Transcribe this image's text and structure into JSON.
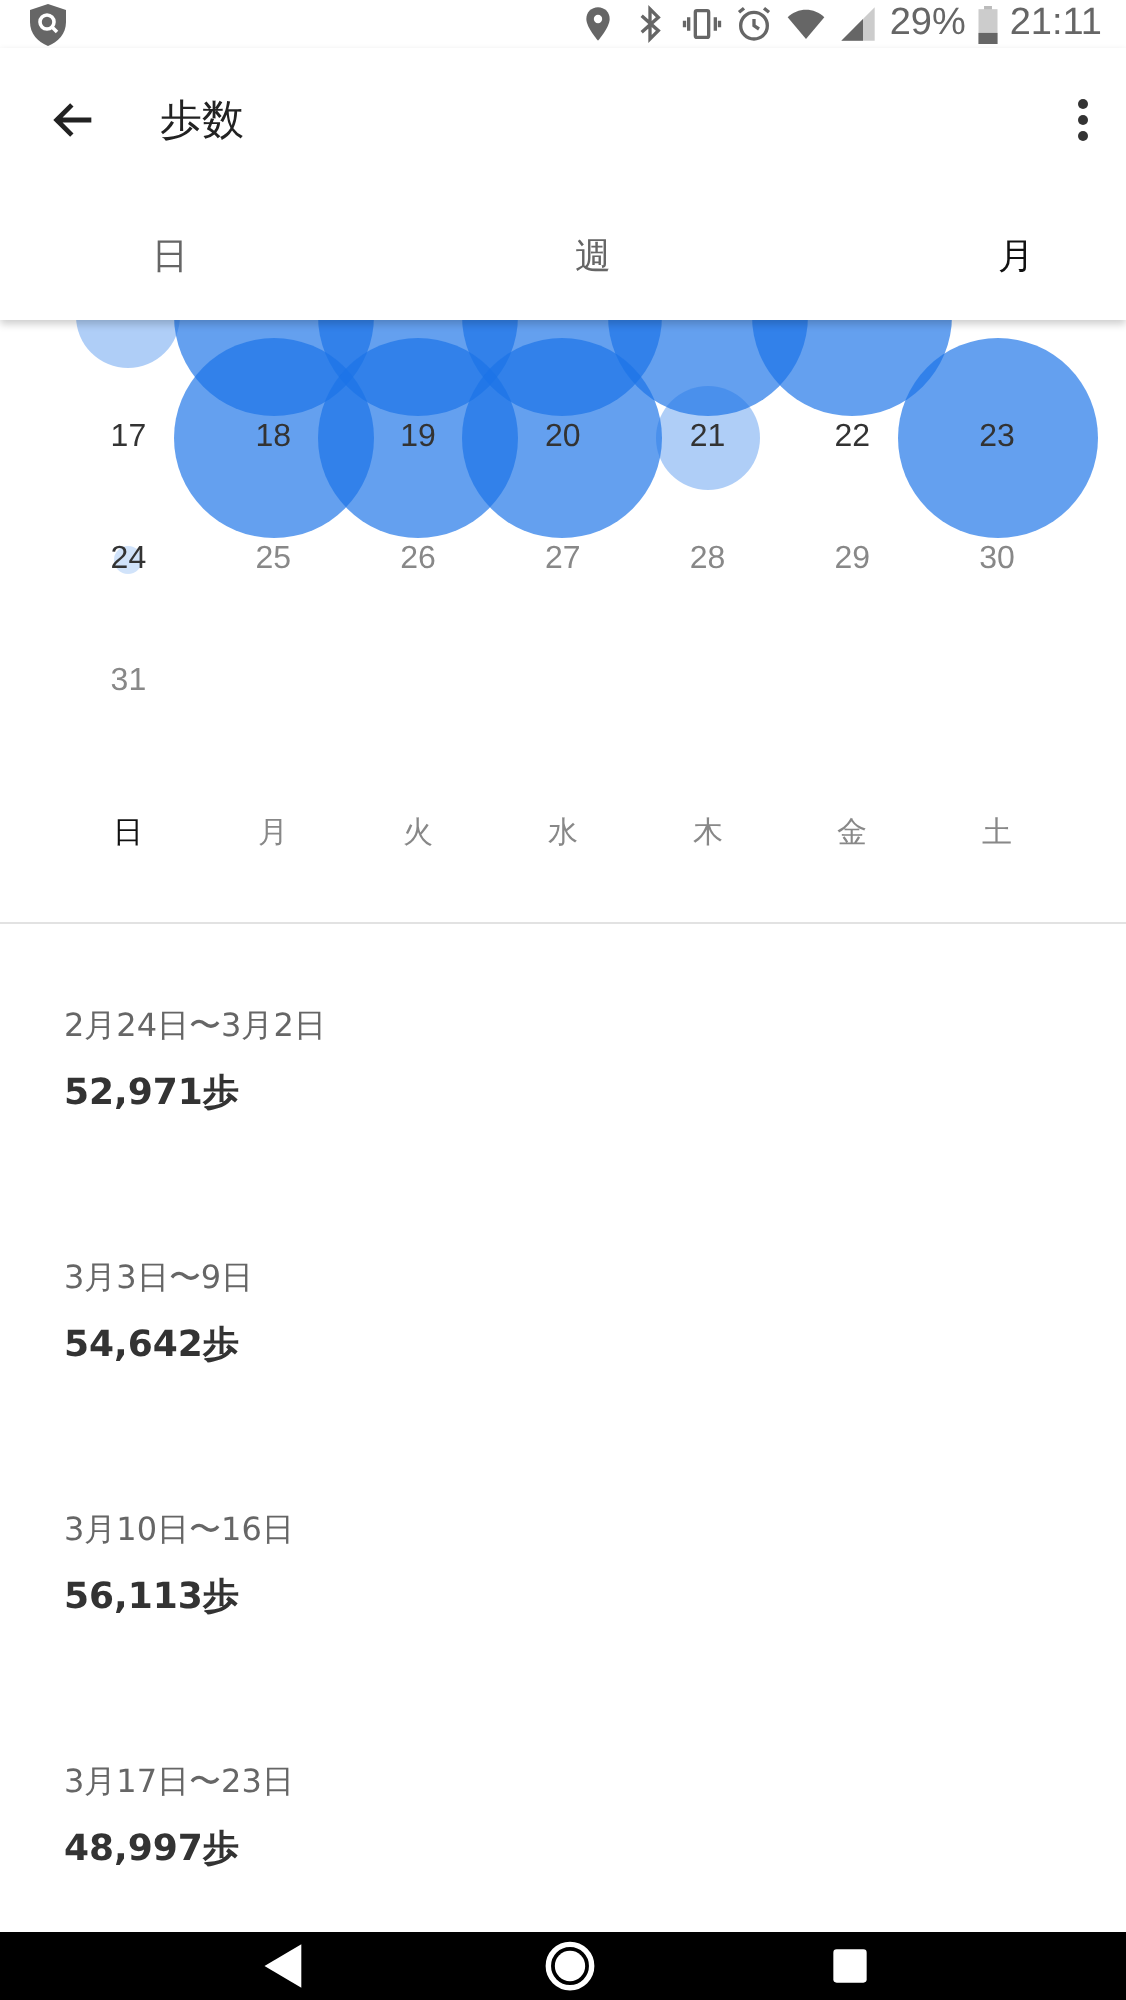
{
  "status_bar": {
    "battery": "29%",
    "time": "21:11"
  },
  "toolbar": {
    "title": "歩数"
  },
  "tabs": [
    {
      "label": "日",
      "selected": false
    },
    {
      "label": "週",
      "selected": false
    },
    {
      "label": "月",
      "selected": true
    }
  ],
  "calendar": {
    "weeks": [
      [
        {
          "kind": "small"
        },
        {
          "kind": "large"
        },
        {
          "kind": "large"
        },
        {
          "kind": "large"
        },
        {
          "kind": "large"
        },
        {
          "kind": "large"
        }
      ],
      [
        {
          "day": "17",
          "kind": "plain",
          "future": false
        },
        {
          "day": "18",
          "kind": "large",
          "future": false
        },
        {
          "day": "19",
          "kind": "large",
          "future": false
        },
        {
          "day": "20",
          "kind": "large",
          "future": false
        },
        {
          "day": "21",
          "kind": "small",
          "future": false
        },
        {
          "day": "22",
          "kind": "plain",
          "future": false
        },
        {
          "day": "23",
          "kind": "large",
          "future": false
        }
      ],
      [
        {
          "day": "24",
          "kind": "tiny",
          "future": false
        },
        {
          "day": "25",
          "kind": "plain",
          "future": true
        },
        {
          "day": "26",
          "kind": "plain",
          "future": true
        },
        {
          "day": "27",
          "kind": "plain",
          "future": true
        },
        {
          "day": "28",
          "kind": "plain",
          "future": true
        },
        {
          "day": "29",
          "kind": "plain",
          "future": true
        },
        {
          "day": "30",
          "kind": "plain",
          "future": true
        }
      ],
      [
        {
          "day": "31",
          "kind": "plain",
          "future": true
        }
      ]
    ],
    "weekdays": [
      {
        "label": "日",
        "highlighted": true
      },
      {
        "label": "月",
        "highlighted": false
      },
      {
        "label": "火",
        "highlighted": false
      },
      {
        "label": "水",
        "highlighted": false
      },
      {
        "label": "木",
        "highlighted": false
      },
      {
        "label": "金",
        "highlighted": false
      },
      {
        "label": "土",
        "highlighted": false
      }
    ]
  },
  "summaries": [
    {
      "range": "2月24日〜3月2日",
      "steps": "52,971歩"
    },
    {
      "range": "3月3日〜9日",
      "steps": "54,642歩"
    },
    {
      "range": "3月10日〜16日",
      "steps": "56,113歩"
    },
    {
      "range": "3月17日〜23日",
      "steps": "48,997歩"
    }
  ]
}
